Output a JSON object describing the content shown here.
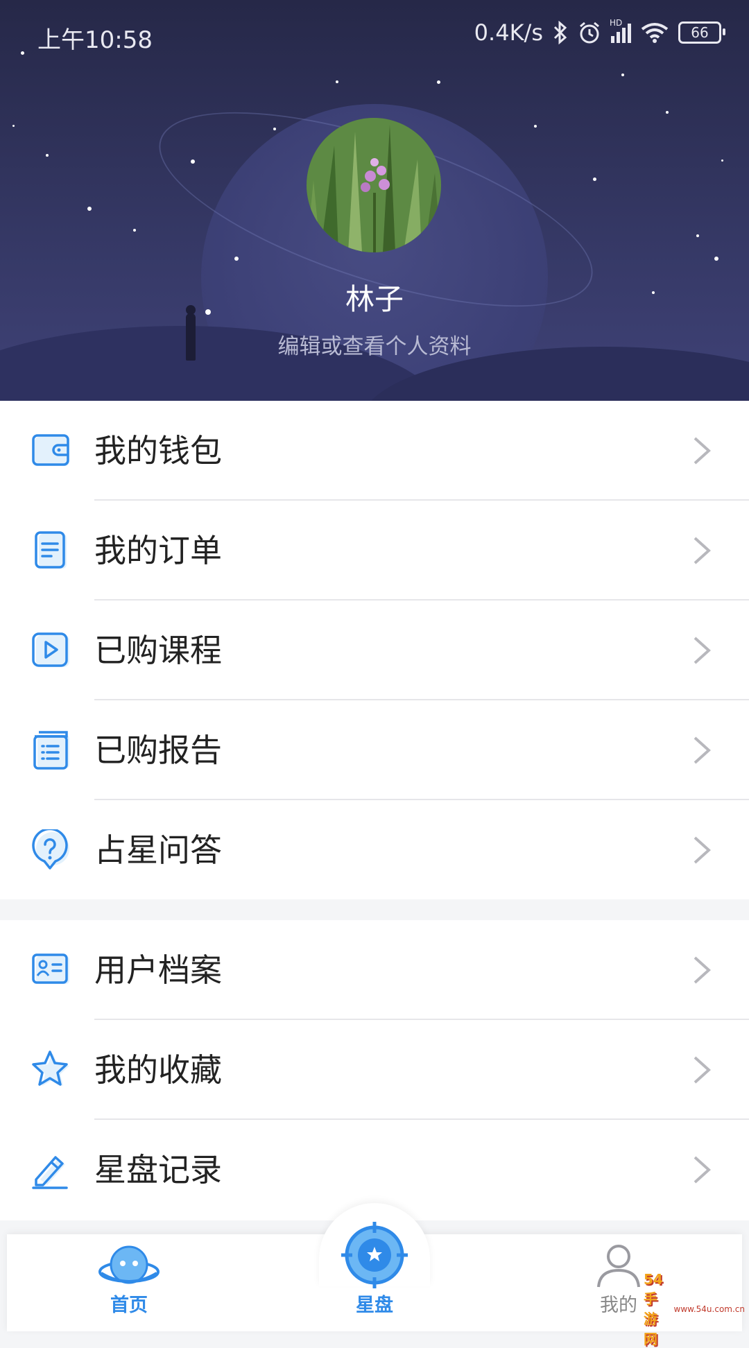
{
  "status_bar": {
    "time": "上午10:58",
    "net_speed": "0.4K/s",
    "network": "HD",
    "battery": "66"
  },
  "profile": {
    "name": "林子",
    "subtitle": "编辑或查看个人资料"
  },
  "menu_group_1": [
    {
      "label": "我的钱包",
      "icon": "wallet-icon"
    },
    {
      "label": "我的订单",
      "icon": "order-icon"
    },
    {
      "label": "已购课程",
      "icon": "video-course-icon"
    },
    {
      "label": "已购报告",
      "icon": "report-icon"
    },
    {
      "label": "占星问答",
      "icon": "question-bubble-icon"
    }
  ],
  "menu_group_2": [
    {
      "label": "用户档案",
      "icon": "profile-card-icon"
    },
    {
      "label": "我的收藏",
      "icon": "star-icon"
    },
    {
      "label": "星盘记录",
      "icon": "pencil-icon"
    }
  ],
  "tab_bar": {
    "items": [
      {
        "label": "首页",
        "icon": "planet-face-icon",
        "active": false
      },
      {
        "label": "星盘",
        "icon": "astro-chart-icon",
        "active": true
      },
      {
        "label": "我的",
        "icon": "user-icon",
        "active": false
      }
    ]
  },
  "watermark": {
    "logo": "54 手游网",
    "url": "www.54u.com.cn"
  },
  "colors": {
    "accent": "#2f8ae8",
    "header_bg": "#343763",
    "icon_light": "#e3f1fc"
  }
}
